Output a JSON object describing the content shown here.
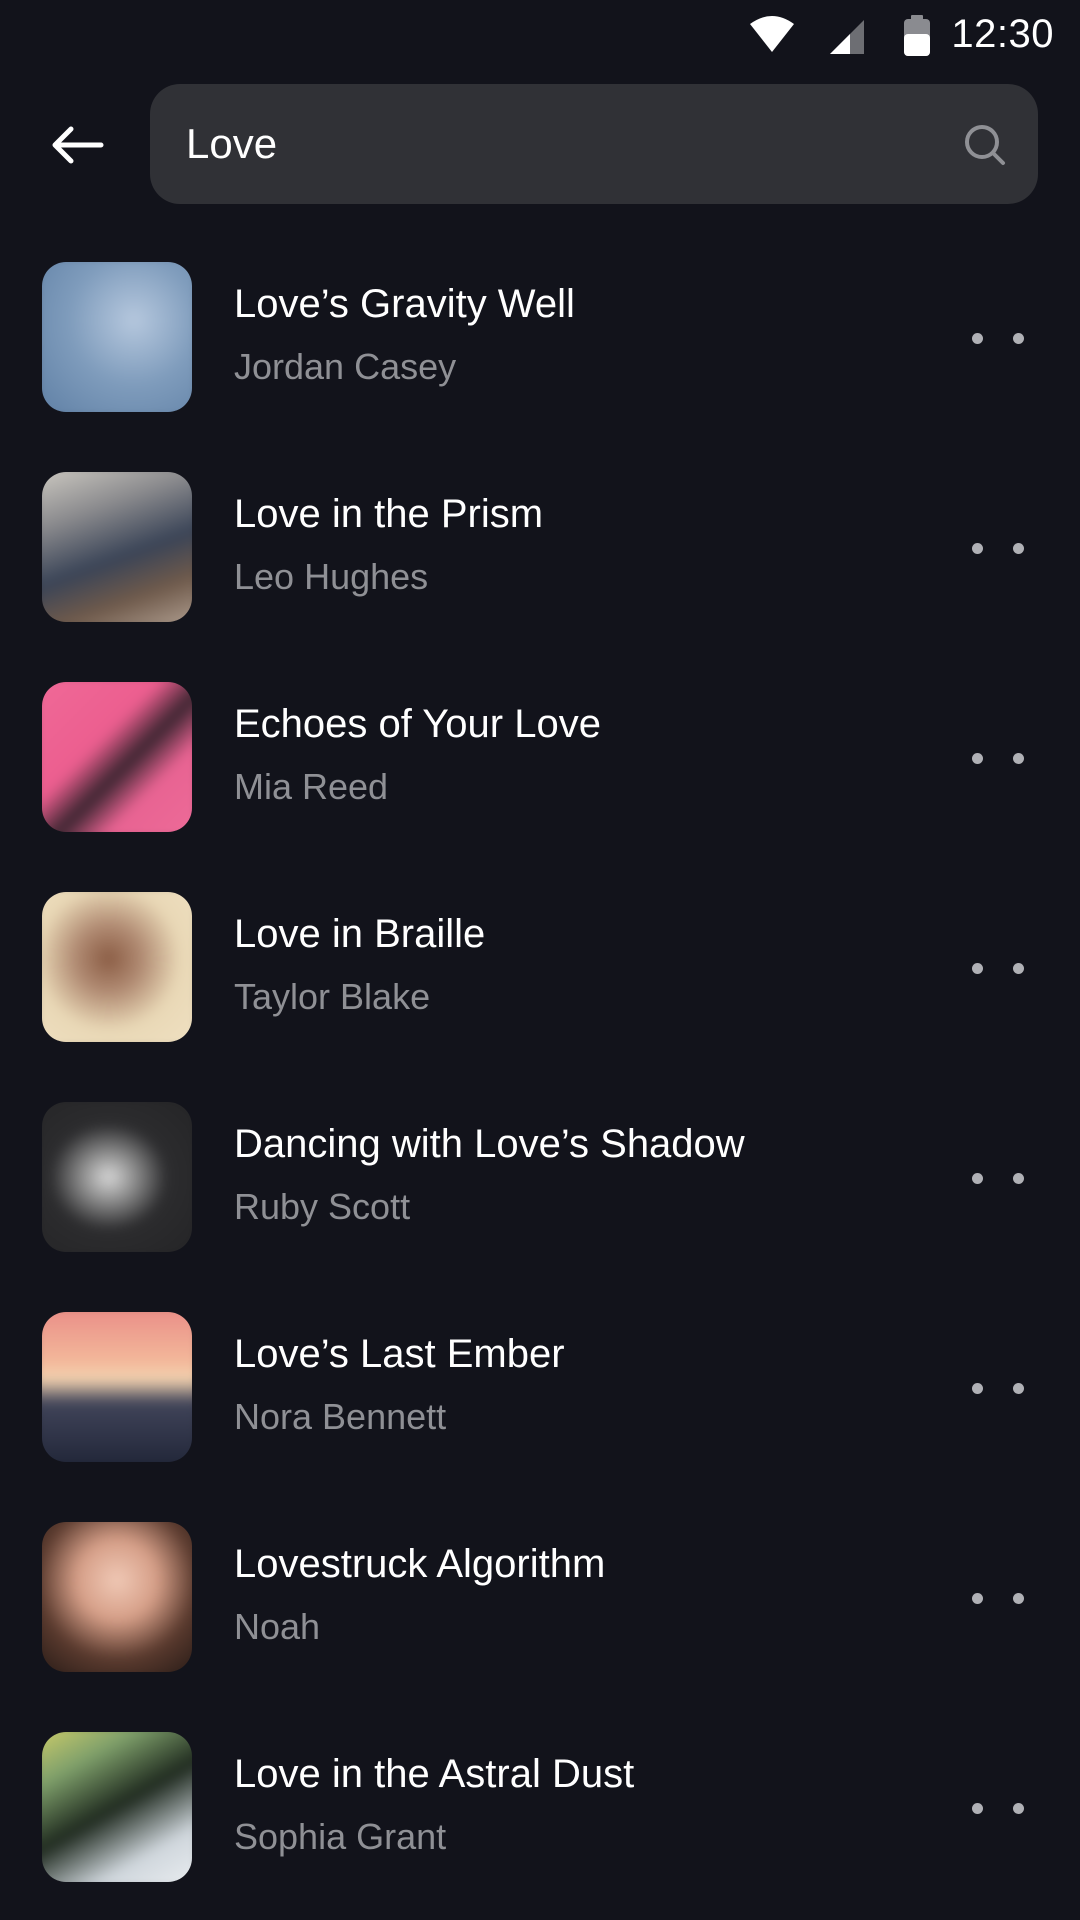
{
  "status_bar": {
    "time": "12:30",
    "icons": [
      "wifi-icon",
      "signal-icon",
      "battery-icon"
    ]
  },
  "header": {
    "back_icon": "arrow-left-icon",
    "search": {
      "value": "Love",
      "placeholder": "",
      "icon": "search-icon"
    }
  },
  "results": [
    {
      "title": "Love’s Gravity Well",
      "artist": "Jordan Casey"
    },
    {
      "title": "Love in the Prism",
      "artist": "Leo Hughes"
    },
    {
      "title": "Echoes of Your Love",
      "artist": "Mia Reed"
    },
    {
      "title": "Love in Braille",
      "artist": "Taylor Blake"
    },
    {
      "title": "Dancing with Love’s Shadow",
      "artist": "Ruby Scott"
    },
    {
      "title": "Love’s Last Ember",
      "artist": "Nora Bennett"
    },
    {
      "title": "Lovestruck Algorithm",
      "artist": "Noah"
    },
    {
      "title": "Love in the Astral Dust",
      "artist": "Sophia Grant"
    }
  ],
  "colors": {
    "background": "#12131b",
    "search_bg": "#303136",
    "title_text": "#ffffff",
    "artist_text": "#8f9095",
    "more_dots": "#b0b1b6"
  }
}
